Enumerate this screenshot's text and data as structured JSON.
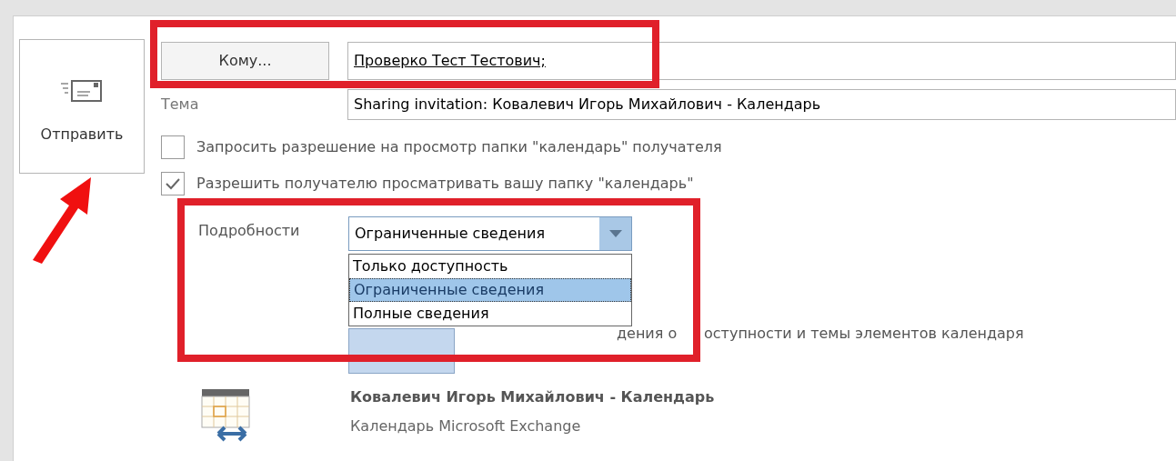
{
  "send_button": {
    "label": "Отправить"
  },
  "to_button": {
    "label": "Кому..."
  },
  "to_field": {
    "value": "Проверко Тест Тестович;"
  },
  "subject": {
    "label": "Тема",
    "value": "Sharing invitation: Ковалевич Игорь Михайлович - Календарь"
  },
  "options": [
    {
      "label": "Запросить разрешение на просмотр папки \"календарь\" получателя",
      "checked": false
    },
    {
      "label": "Разрешить получателю просматривать вашу папку \"календарь\"",
      "checked": true
    }
  ],
  "details": {
    "label": "Подробности",
    "value": "Ограниченные сведения",
    "expanded": true,
    "options": [
      {
        "label": "Только доступность",
        "selected": false
      },
      {
        "label": "Ограниченные сведения",
        "selected": true
      },
      {
        "label": "Полные сведения",
        "selected": false
      }
    ]
  },
  "partial_text": [
    "дения о",
    "оступности и темы элементов календаря"
  ],
  "calendar": {
    "title": "Ковалевич Игорь Михайлович - Календарь",
    "subtitle": "Календарь Microsoft Exchange"
  }
}
